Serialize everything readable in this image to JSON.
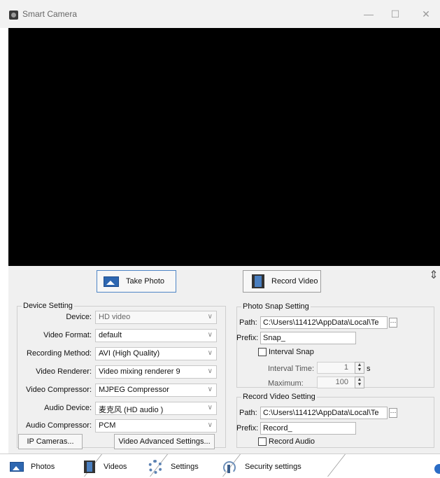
{
  "window": {
    "title": "Smart Camera",
    "controls": {
      "minimize": "—",
      "maximize": "☐",
      "close": "✕"
    }
  },
  "toolbar": {
    "take_photo": "Take Photo",
    "record_video": "Record Video",
    "toggle_icon": "collapse-toggle-icon"
  },
  "device_setting": {
    "title": "Device Setting",
    "rows": [
      {
        "label": "Device:",
        "value": "HD video"
      },
      {
        "label": "Video Format:",
        "value": "default"
      },
      {
        "label": "Recording Method:",
        "value": "AVI (High Quality)"
      },
      {
        "label": "Video Renderer:",
        "value": "Video mixing renderer 9"
      },
      {
        "label": "Video Compressor:",
        "value": "MJPEG Compressor"
      },
      {
        "label": "Audio Device:",
        "value": "麦克风 (HD audio )"
      },
      {
        "label": "Audio Compressor:",
        "value": "PCM"
      }
    ],
    "ip_cameras": "IP Cameras...",
    "advanced": "Video Advanced Settings..."
  },
  "photo_snap": {
    "title": "Photo Snap Setting",
    "path_label": "Path:",
    "path_value": "C:\\Users\\11412\\AppData\\Local\\Te",
    "browse": "···",
    "prefix_label": "Prefix:",
    "prefix_value": "Snap_",
    "interval_snap": "Interval Snap",
    "interval_time_label": "Interval Time:",
    "interval_time_value": "1",
    "interval_unit": "s",
    "maximum_label": "Maximum:",
    "maximum_value": "100"
  },
  "record_video": {
    "title": "Record Video Setting",
    "path_label": "Path:",
    "path_value": "C:\\Users\\11412\\AppData\\Local\\Te",
    "browse": "···",
    "prefix_label": "Prefix:",
    "prefix_value": "Record_",
    "record_audio": "Record Audio"
  },
  "tabs": [
    {
      "label": "Photos",
      "icon": "photo-icon"
    },
    {
      "label": "Videos",
      "icon": "film-icon"
    },
    {
      "label": "Settings",
      "icon": "gear-icon"
    },
    {
      "label": "Security settings",
      "icon": "antenna-icon"
    }
  ],
  "colors": {
    "accent": "#2e67b1",
    "panel": "#f0f0f0",
    "video_bg": "#000000"
  }
}
